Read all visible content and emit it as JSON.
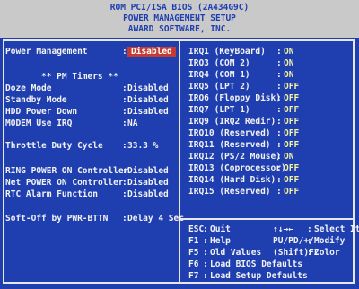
{
  "header": {
    "line1": "ROM PCI/ISA BIOS (2A434G9C)",
    "line2": "POWER MANAGEMENT SETUP",
    "line3": "AWARD SOFTWARE, INC."
  },
  "left": {
    "power_management": {
      "label": "Power Management",
      "value": "Disabled"
    },
    "pm_timers_title": "** PM Timers **",
    "doze_mode": {
      "label": "Doze Mode",
      "value": "Disabled"
    },
    "standby_mode": {
      "label": "Standby Mode",
      "value": "Disabled"
    },
    "hdd_power_down": {
      "label": "HDD Power Down",
      "value": "Disabled"
    },
    "modem_use_irq": {
      "label": "MODEM Use IRQ",
      "value": "NA"
    },
    "throttle_duty_cycle": {
      "label": "Throttle Duty Cycle",
      "value": "33.3 %"
    },
    "ring_power_on": {
      "label": "RING POWER ON Controller",
      "value": "Disabled"
    },
    "net_power_on": {
      "label": "Net POWER ON Controller",
      "value": "Disabled"
    },
    "rtc_alarm": {
      "label": "RTC Alarm Function",
      "value": "Disabled"
    },
    "soft_off": {
      "label": "Soft-Off by PWR-BTTN",
      "value": "Delay 4 Sec"
    }
  },
  "irqs": [
    {
      "label": "IRQ1  (KeyBoard)",
      "value": "ON"
    },
    {
      "label": "IRQ3  (COM 2)",
      "value": "ON"
    },
    {
      "label": "IRQ4  (COM 1)",
      "value": "ON"
    },
    {
      "label": "IRQ5  (LPT 2)",
      "value": "OFF"
    },
    {
      "label": "IRQ6  (Floppy Disk)",
      "value": "OFF"
    },
    {
      "label": "IRQ7  (LPT 1)",
      "value": "OFF"
    },
    {
      "label": "IRQ9  (IRQ2 Redir)",
      "value": "OFF"
    },
    {
      "label": "IRQ10 (Reserved)",
      "value": "OFF"
    },
    {
      "label": "IRQ11 (Reserved)",
      "value": "OFF"
    },
    {
      "label": "IRQ12 (PS/2 Mouse)",
      "value": "ON"
    },
    {
      "label": "IRQ13 (Coprocessor)",
      "value": "OFF"
    },
    {
      "label": "IRQ14 (Hard Disk)",
      "value": "OFF"
    },
    {
      "label": "IRQ15 (Reserved)",
      "value": "OFF"
    }
  ],
  "help": {
    "esc_key": "ESC",
    "esc_text": "Quit",
    "arrows_key": "↑↓→←",
    "arrows_text": "Select Item",
    "f1_key": "F1",
    "f1_text": "Help",
    "pu_key": "PU/PD/+/-",
    "pu_text": "Modify",
    "f5_key": "F5",
    "f5_text": "Old Values",
    "shift_key": "(Shift)F2",
    "shift_text": "Color",
    "f6_key": "F6",
    "f6_text": "Load BIOS  Defaults",
    "f7_key": "F7",
    "f7_text": "Load Setup Defaults",
    "colon": ":"
  },
  "colors": {
    "background": "#1f3fb0",
    "header": "#c9c9c9",
    "selection": "#c43b32",
    "irq_value": "#f2f2a0"
  }
}
